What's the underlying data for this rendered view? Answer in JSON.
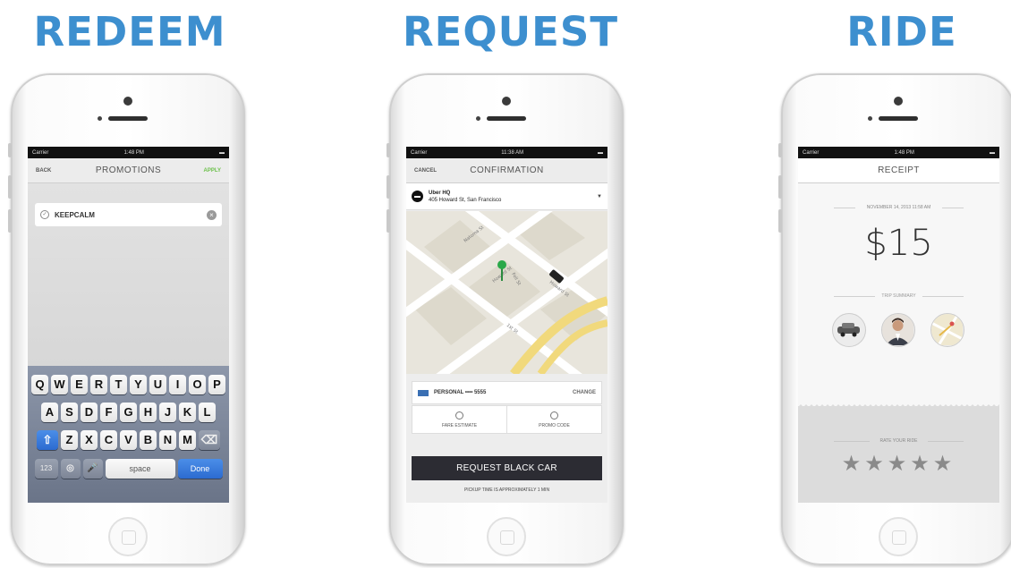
{
  "steps": [
    {
      "title": "REDEEM"
    },
    {
      "title": "REQUEST"
    },
    {
      "title": "RIDE"
    }
  ],
  "status_bar": {
    "carrier": "Carrier",
    "time_1": "1:48 PM",
    "time_2": "11:38 AM",
    "time_3": "1:48 PM"
  },
  "screen1": {
    "nav_left": "BACK",
    "nav_title": "PROMOTIONS",
    "nav_right": "APPLY",
    "promo_code": "KEEPCALM",
    "keyboard": {
      "row1": [
        "Q",
        "W",
        "E",
        "R",
        "T",
        "Y",
        "U",
        "I",
        "O",
        "P"
      ],
      "row2": [
        "A",
        "S",
        "D",
        "F",
        "G",
        "H",
        "J",
        "K",
        "L"
      ],
      "row3": [
        "Z",
        "X",
        "C",
        "V",
        "B",
        "N",
        "M"
      ],
      "numbers_key": "123",
      "space_key": "space",
      "done_key": "Done"
    }
  },
  "screen2": {
    "nav_left": "CANCEL",
    "nav_title": "CONFIRMATION",
    "address_name": "Uber HQ",
    "address_line": "405 Howard St, San Francisco",
    "street_1": "Natoma St",
    "street_2": "Howard St",
    "street_3": "Howard St",
    "street_4": "1st St",
    "street_5": "Fell St",
    "payment_label": "PERSONAL •••• 5555",
    "payment_action": "CHANGE",
    "option_1": "FARE ESTIMATE",
    "option_2": "PROMO CODE",
    "request_button": "REQUEST BLACK CAR",
    "pickup_note": "PICKUP TIME IS APPROXIMATELY 1 MIN"
  },
  "screen3": {
    "nav_title": "RECEIPT",
    "date": "NOVEMBER 14, 2013 11:58 AM",
    "amount": "$15",
    "trip_summary": "TRIP SUMMARY",
    "rate_label": "RATE YOUR RIDE",
    "stars": "★★★★★",
    "rating_max": 5
  },
  "colors": {
    "title_blue": "#3d8fcf",
    "apply_green": "#6cc04a",
    "keyboard_done": "#2c6bd0",
    "request_button": "#2c2c33",
    "map_pin": "#2aa84a"
  }
}
